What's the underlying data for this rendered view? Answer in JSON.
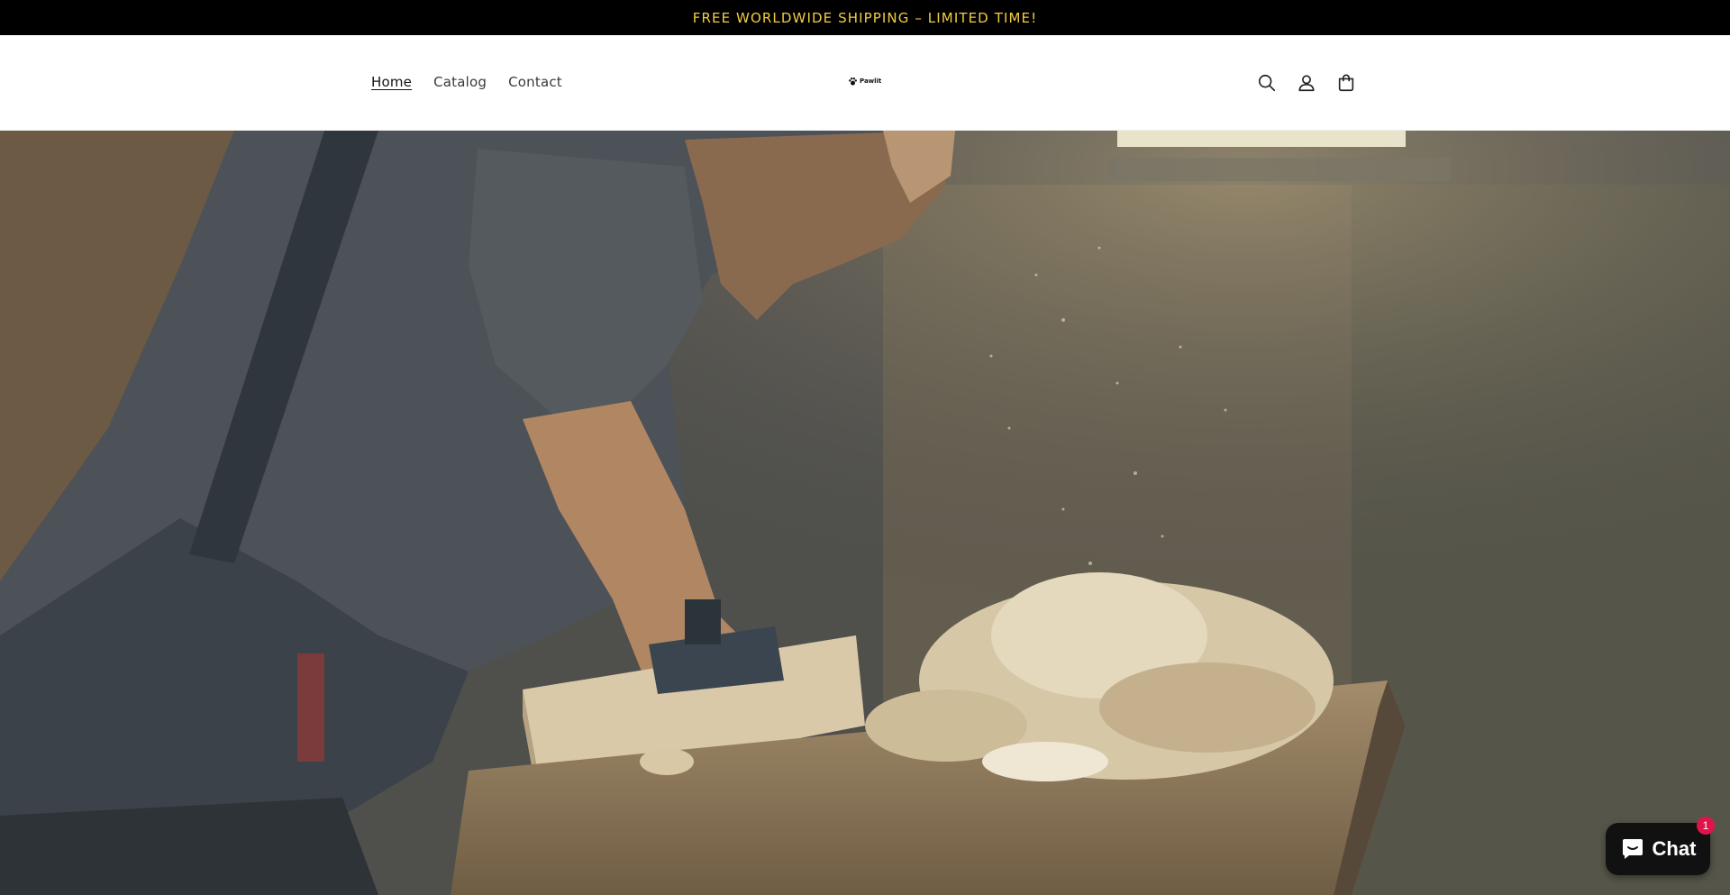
{
  "announcement": {
    "text": "FREE WORLDWIDE SHIPPING – LIMITED TIME!"
  },
  "header": {
    "nav": [
      {
        "label": "Home",
        "active": true
      },
      {
        "label": "Catalog",
        "active": false
      },
      {
        "label": "Contact",
        "active": false
      }
    ],
    "logo_text": "Pawlit",
    "icons": [
      "search-icon",
      "account-icon",
      "cart-icon"
    ]
  },
  "hero": {
    "image": "woodworker-planing-wood-photo"
  },
  "chat": {
    "label": "Chat",
    "badge_count": "1"
  },
  "colors": {
    "announcement_bg": "#000000",
    "announcement_text": "#f3cd40",
    "chat_bg": "#111111",
    "badge": "#e0144c"
  }
}
